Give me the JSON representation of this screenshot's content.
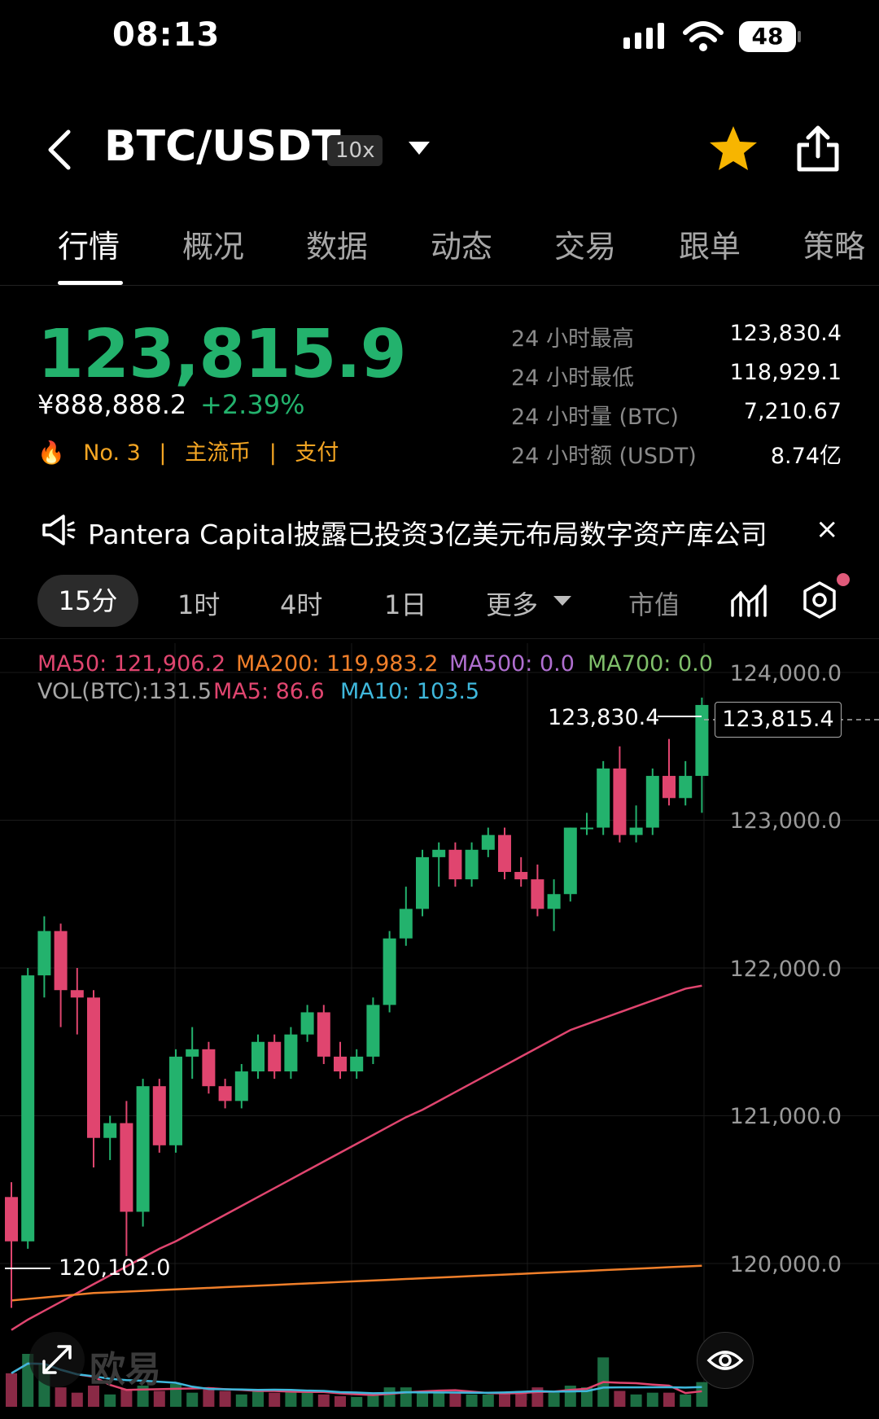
{
  "status_bar": {
    "time": "08:13",
    "battery": "48"
  },
  "header": {
    "pair": "BTC/USDT",
    "leverage": "10x"
  },
  "tabs": [
    "行情",
    "概况",
    "数据",
    "动态",
    "交易",
    "跟单",
    "策略"
  ],
  "ticker": {
    "last_price": "123,815.9",
    "cny_price": "¥888,888.2",
    "change_pct": "+2.39%",
    "rank": "No. 3",
    "tag1": "主流币",
    "tag2": "支付",
    "sep": "|"
  },
  "stats": [
    {
      "label": "24 小时最高",
      "value": "123,830.4"
    },
    {
      "label": "24 小时最低",
      "value": "118,929.1"
    },
    {
      "label": "24 小时量 (BTC)",
      "value": "7,210.67"
    },
    {
      "label": "24 小时额 (USDT)",
      "value": "8.74亿"
    }
  ],
  "news": {
    "text": "Pantera Capital披露已投资3亿美元布局数字资产库公司",
    "close": "×"
  },
  "intervals": {
    "active": "15分",
    "items": [
      "1时",
      "4时",
      "1日",
      "更多",
      "市值"
    ]
  },
  "indicators": {
    "ma50": "MA50: 121,906.2",
    "ma200": "MA200: 119,983.2",
    "ma500": "MA500: 0.0",
    "ma700": "MA700: 0.0",
    "vol": "VOL(BTC):131.5",
    "ma5": "MA5: 86.6",
    "ma10": "MA10: 103.5"
  },
  "axis_labels": [
    "124,000.0",
    "123,000.0",
    "122,000.0",
    "121,000.0",
    "120,000.0"
  ],
  "chart_markers": {
    "high": "123,830.4",
    "low": "120,102.0",
    "current": "123,815.4"
  },
  "watermark": "欧易",
  "colors": {
    "up": "#23b26d",
    "down": "#e0456f",
    "ma50": "#e0456f",
    "ma200": "#f07f2a",
    "ma500": "#b06fd0",
    "ma700": "#7fbf6a",
    "ma10": "#3fb8dc"
  },
  "chart_data": {
    "type": "candlestick",
    "ylim": [
      119450,
      124200
    ],
    "y_ticks": [
      124000,
      123000,
      122000,
      121000,
      120000
    ],
    "candles": [
      {
        "o": 120450,
        "c": 120150,
        "h": 120550,
        "l": 119700
      },
      {
        "o": 120150,
        "c": 121950,
        "h": 122000,
        "l": 120100
      },
      {
        "o": 121950,
        "c": 122250,
        "h": 122350,
        "l": 121800
      },
      {
        "o": 122250,
        "c": 121850,
        "h": 122300,
        "l": 121600
      },
      {
        "o": 121850,
        "c": 121800,
        "h": 122000,
        "l": 121550
      },
      {
        "o": 121800,
        "c": 120850,
        "h": 121850,
        "l": 120650
      },
      {
        "o": 120850,
        "c": 120950,
        "h": 121000,
        "l": 120700
      },
      {
        "o": 120950,
        "c": 120350,
        "h": 121100,
        "l": 120050
      },
      {
        "o": 120350,
        "c": 121200,
        "h": 121250,
        "l": 120250
      },
      {
        "o": 121200,
        "c": 120800,
        "h": 121250,
        "l": 120750
      },
      {
        "o": 120800,
        "c": 121400,
        "h": 121450,
        "l": 120750
      },
      {
        "o": 121400,
        "c": 121450,
        "h": 121600,
        "l": 121250
      },
      {
        "o": 121450,
        "c": 121200,
        "h": 121500,
        "l": 121150
      },
      {
        "o": 121200,
        "c": 121100,
        "h": 121250,
        "l": 121050
      },
      {
        "o": 121100,
        "c": 121300,
        "h": 121350,
        "l": 121050
      },
      {
        "o": 121300,
        "c": 121500,
        "h": 121550,
        "l": 121250
      },
      {
        "o": 121500,
        "c": 121300,
        "h": 121550,
        "l": 121250
      },
      {
        "o": 121300,
        "c": 121550,
        "h": 121600,
        "l": 121250
      },
      {
        "o": 121550,
        "c": 121700,
        "h": 121750,
        "l": 121500
      },
      {
        "o": 121700,
        "c": 121400,
        "h": 121750,
        "l": 121350
      },
      {
        "o": 121400,
        "c": 121300,
        "h": 121500,
        "l": 121250
      },
      {
        "o": 121300,
        "c": 121400,
        "h": 121450,
        "l": 121250
      },
      {
        "o": 121400,
        "c": 121750,
        "h": 121800,
        "l": 121350
      },
      {
        "o": 121750,
        "c": 122200,
        "h": 122250,
        "l": 121700
      },
      {
        "o": 122200,
        "c": 122400,
        "h": 122550,
        "l": 122150
      },
      {
        "o": 122400,
        "c": 122750,
        "h": 122800,
        "l": 122350
      },
      {
        "o": 122750,
        "c": 122800,
        "h": 122850,
        "l": 122550
      },
      {
        "o": 122800,
        "c": 122600,
        "h": 122850,
        "l": 122550
      },
      {
        "o": 122600,
        "c": 122800,
        "h": 122850,
        "l": 122550
      },
      {
        "o": 122800,
        "c": 122900,
        "h": 122950,
        "l": 122750
      },
      {
        "o": 122900,
        "c": 122650,
        "h": 122950,
        "l": 122600
      },
      {
        "o": 122650,
        "c": 122600,
        "h": 122750,
        "l": 122550
      },
      {
        "o": 122600,
        "c": 122400,
        "h": 122700,
        "l": 122350
      },
      {
        "o": 122400,
        "c": 122500,
        "h": 122600,
        "l": 122250
      },
      {
        "o": 122500,
        "c": 122950,
        "h": 122950,
        "l": 122450
      },
      {
        "o": 122950,
        "c": 122950,
        "h": 123050,
        "l": 122900
      },
      {
        "o": 122950,
        "c": 123350,
        "h": 123400,
        "l": 122900
      },
      {
        "o": 123350,
        "c": 122900,
        "h": 123500,
        "l": 122850
      },
      {
        "o": 122900,
        "c": 122950,
        "h": 123100,
        "l": 122850
      },
      {
        "o": 122950,
        "c": 123300,
        "h": 123350,
        "l": 122900
      },
      {
        "o": 123300,
        "c": 123150,
        "h": 123550,
        "l": 123100
      },
      {
        "o": 123150,
        "c": 123300,
        "h": 123400,
        "l": 123100
      },
      {
        "o": 123300,
        "c": 123780,
        "h": 123830,
        "l": 123050
      }
    ],
    "volume_max": 300,
    "volumes": [
      95,
      150,
      120,
      55,
      40,
      60,
      35,
      50,
      60,
      45,
      65,
      40,
      55,
      45,
      35,
      50,
      40,
      45,
      40,
      35,
      30,
      28,
      35,
      55,
      55,
      45,
      40,
      40,
      35,
      35,
      40,
      45,
      55,
      40,
      60,
      55,
      140,
      45,
      35,
      40,
      40,
      35,
      70
    ],
    "ma50_series": [
      119550,
      119620,
      119680,
      119740,
      119800,
      119860,
      119920,
      119980,
      120040,
      120100,
      120150,
      120210,
      120270,
      120330,
      120390,
      120450,
      120510,
      120570,
      120630,
      120690,
      120750,
      120810,
      120870,
      120930,
      120990,
      121040,
      121100,
      121160,
      121220,
      121280,
      121340,
      121400,
      121460,
      121520,
      121580,
      121620,
      121660,
      121700,
      121740,
      121780,
      121820,
      121860,
      121880
    ],
    "ma200_series": [
      119750,
      119760,
      119770,
      119780,
      119790,
      119800,
      119805,
      119810,
      119815,
      119820,
      119825,
      119830,
      119835,
      119840,
      119845,
      119850,
      119855,
      119860,
      119865,
      119870,
      119875,
      119880,
      119885,
      119890,
      119895,
      119900,
      119905,
      119910,
      119915,
      119920,
      119925,
      119930,
      119935,
      119940,
      119945,
      119950,
      119955,
      119960,
      119965,
      119970,
      119975,
      119980,
      119985
    ]
  }
}
